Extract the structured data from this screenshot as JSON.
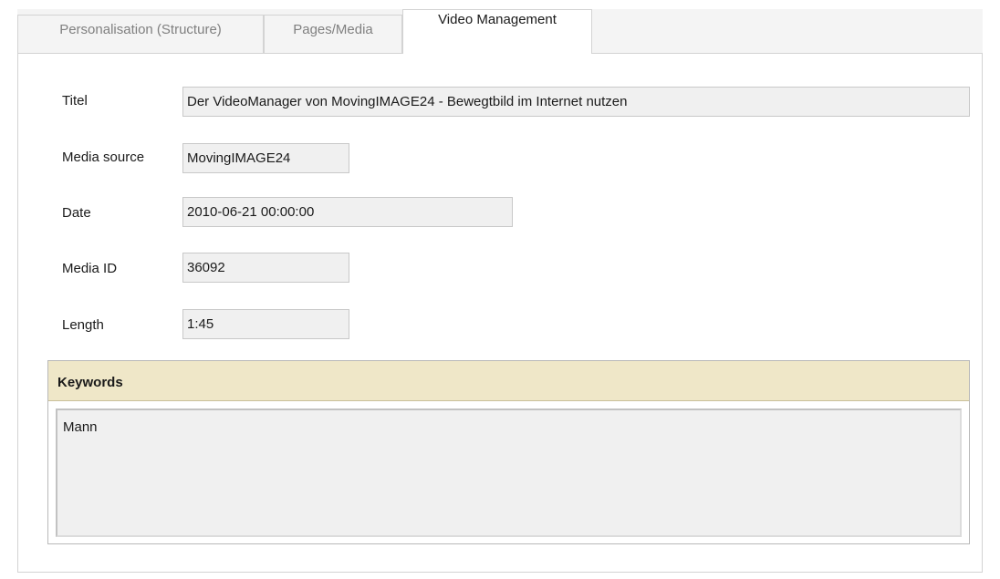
{
  "tabs": [
    {
      "label": "Personalisation (Structure)",
      "active": false
    },
    {
      "label": "Pages/Media",
      "active": false
    },
    {
      "label": "Video Management",
      "active": true
    }
  ],
  "form": {
    "title": {
      "label": "Titel",
      "value": "Der VideoManager von MovingIMAGE24 - Bewegtbild im Internet nutzen"
    },
    "media_source": {
      "label": "Media source",
      "value": "MovingIMAGE24"
    },
    "date": {
      "label": "Date",
      "value": "2010-06-21 00:00:00"
    },
    "media_id": {
      "label": "Media ID",
      "value": "36092"
    },
    "length": {
      "label": "Length",
      "value": "1:45"
    }
  },
  "keywords": {
    "legend": "Keywords",
    "value": "Mann"
  },
  "colors": {
    "legend_background": "#efe7c8",
    "field_background": "#f0f0f0",
    "border": "#d3d3d3",
    "inactive_tab_text": "#808080"
  }
}
